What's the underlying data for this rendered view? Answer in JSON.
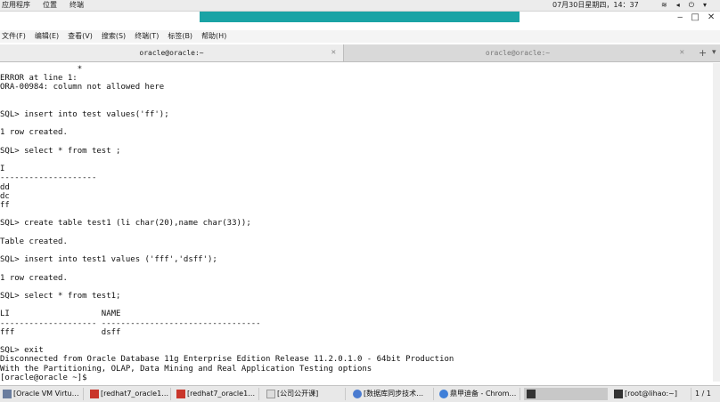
{
  "topbar": {
    "menus": [
      "应用程序",
      "位置",
      "终端"
    ],
    "clock": "07月30日星期四，14：37"
  },
  "terminal_menu": [
    "文件(F)",
    "编辑(E)",
    "查看(V)",
    "搜索(S)",
    "终端(T)",
    "标签(B)",
    "帮助(H)"
  ],
  "tabs": [
    "oracle@oracle:~",
    "oracle@oracle:~"
  ],
  "terminal_lines": [
    "                *",
    "ERROR at line 1:",
    "ORA-00984: column not allowed here",
    "",
    "",
    "SQL> insert into test values('ff');",
    "",
    "1 row created.",
    "",
    "SQL> select * from test ;",
    "",
    "I",
    "--------------------",
    "dd",
    "dc",
    "ff",
    "",
    "SQL> create table test1 (li char(20),name char(33));",
    "",
    "Table created.",
    "",
    "SQL> insert into test1 values ('fff','dsff');",
    "",
    "1 row created.",
    "",
    "SQL> select * from test1;",
    "",
    "LI                   NAME",
    "-------------------- ---------------------------------",
    "fff                  dsff",
    "",
    "SQL> exit",
    "Disconnected from Oracle Database 11g Enterprise Edition Release 11.2.0.1.0 - 64bit Production",
    "With the Partitioning, OLAP, Data Mining and Real Application Testing options",
    "[oracle@oracle ~]$"
  ],
  "taskbar": {
    "tasks": [
      "[Oracle VM Virtu…",
      "[redhat7_oracle1…",
      "[redhat7_oracle1…",
      "[公司公开课]",
      "[数据库同步技术…",
      "鼎甲迪备 - Chrom…",
      "",
      "[root@lihao:~]"
    ],
    "pager": "1 / 1"
  }
}
